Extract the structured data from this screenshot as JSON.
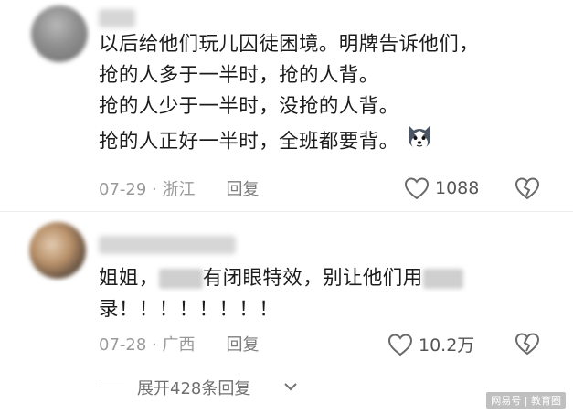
{
  "comments": [
    {
      "lines": [
        "以后给他们玩儿囚徒困境。明牌告诉他们，",
        "抢的人多于一半时，抢的人背。",
        "抢的人少于一半时，没抢的人背。",
        "抢的人正好一半时，全班都要背。"
      ],
      "emoji_icon": "husky-dog-emoji-icon",
      "date": "07-29",
      "location": "浙江",
      "reply_label": "回复",
      "likes": "1088"
    },
    {
      "line1_prefix": "姐姐，",
      "line1_mid": "有闭眼特效，别让他们用",
      "line2": "录！！！！！！！！",
      "date": "07-28",
      "location": "广西",
      "reply_label": "回复",
      "likes": "10.2万"
    }
  ],
  "meta_separator": " · ",
  "expand": {
    "label": "展开428条回复"
  },
  "watermark": "网易号 | 教育圈",
  "colors": {
    "text": "#1c1c1c",
    "meta": "#9a9a9a",
    "divider": "#ededed"
  }
}
